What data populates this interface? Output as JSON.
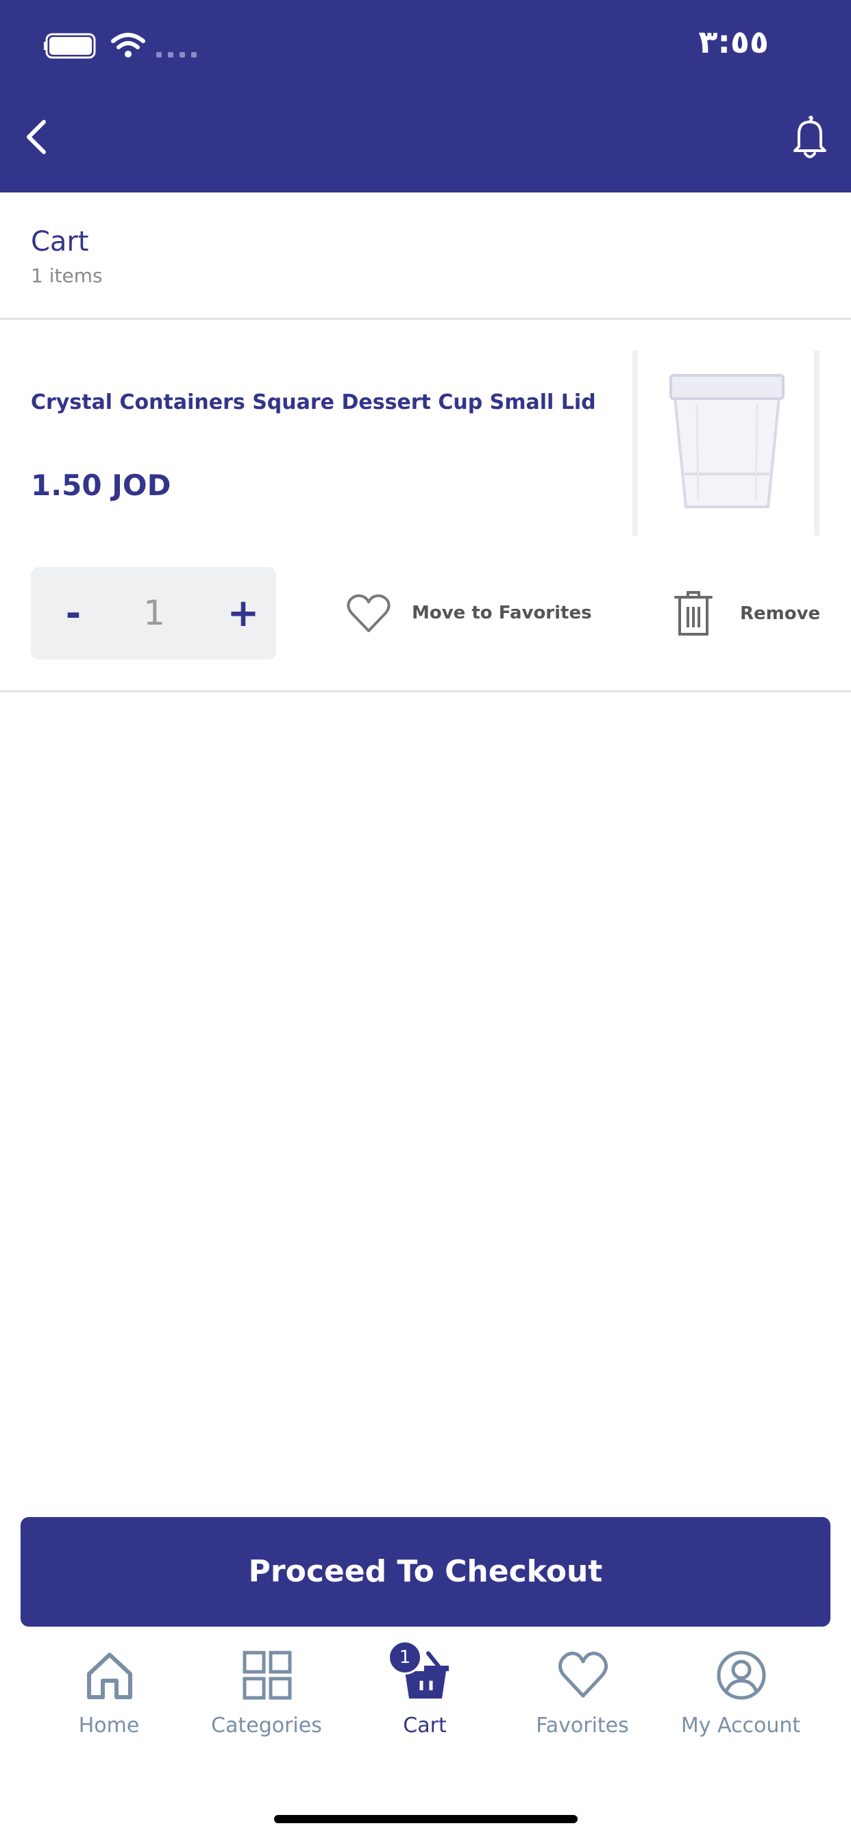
{
  "status_bar": {
    "time": "٣:٥٥"
  },
  "header": {
    "back_icon": "chevron-left-icon",
    "notifications_icon": "bell-icon"
  },
  "cart": {
    "title": "Cart",
    "item_count_label": "1 items"
  },
  "items": [
    {
      "name": "Crystal Containers Square Dessert Cup Small Lid",
      "price": "1.50 JOD",
      "quantity": "1",
      "minus_label": "-",
      "plus_label": "+",
      "move_to_favorites_label": "Move to Favorites",
      "remove_label": "Remove"
    }
  ],
  "checkout": {
    "label": "Proceed To Checkout"
  },
  "bottom_nav": {
    "items": [
      {
        "label": "Home",
        "icon": "home-icon"
      },
      {
        "label": "Categories",
        "icon": "grid-icon"
      },
      {
        "label": "Cart",
        "icon": "basket-icon",
        "badge": "1",
        "active": true
      },
      {
        "label": "Favorites",
        "icon": "heart-icon"
      },
      {
        "label": "My Account",
        "icon": "user-icon"
      }
    ]
  },
  "colors": {
    "primary": "#33358a",
    "nav_inactive": "#7a8fa6",
    "divider": "#e3e3e3"
  }
}
